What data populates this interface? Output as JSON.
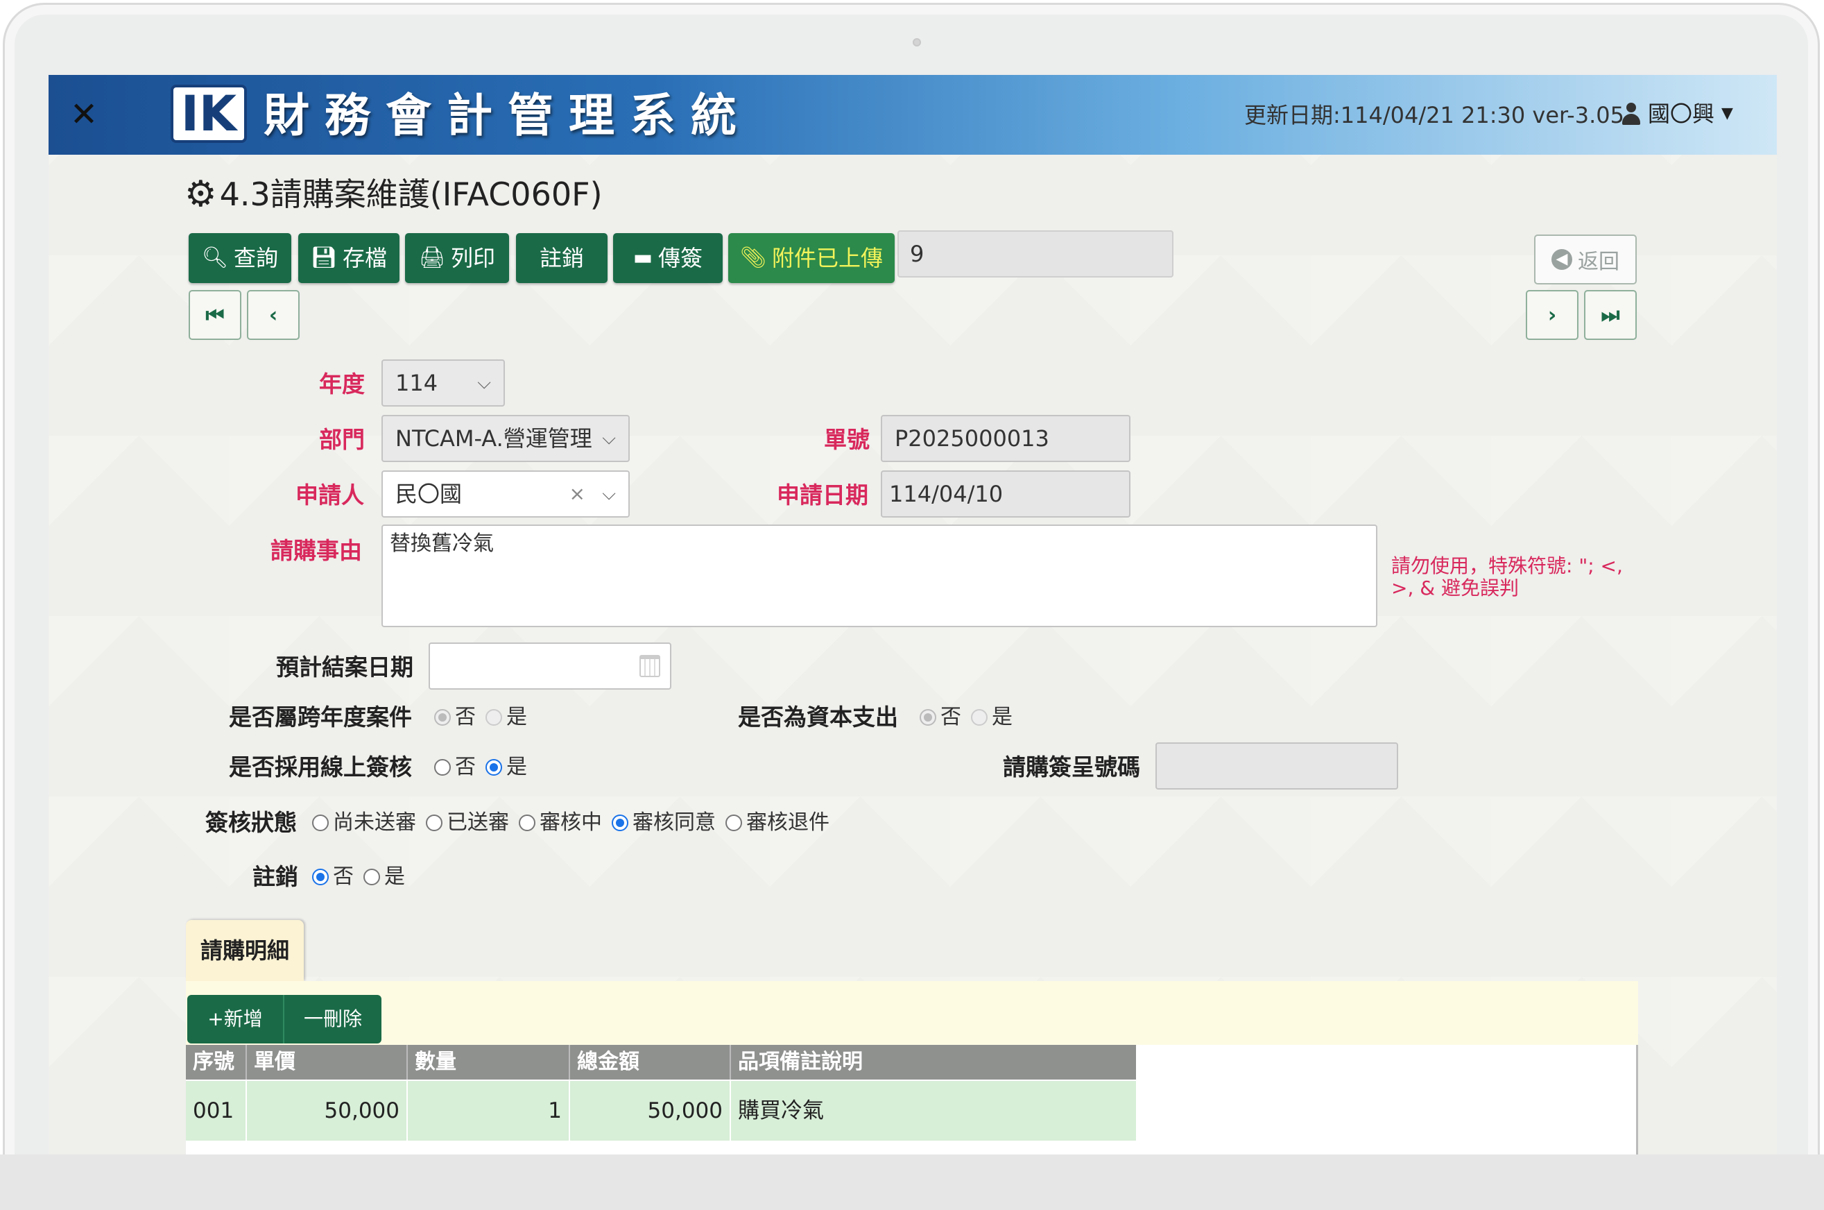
{
  "header": {
    "logo_text": "IK",
    "app_title": "財務會計管理系統",
    "update_info": "更新日期:114/04/21 21:30 ver-3.05",
    "user_name": "國〇興"
  },
  "page": {
    "title": "4.3請購案維護(IFAC060F)"
  },
  "toolbar": {
    "query_label": "查詢",
    "save_label": "存檔",
    "print_label": "列印",
    "cancel_label": "註銷",
    "sign_label": "傳簽",
    "attach_label": "附件已上傳",
    "attach_count": "9",
    "back_label": "返回"
  },
  "form": {
    "year_label": "年度",
    "year_value": "114",
    "dept_label": "部門",
    "dept_value": "NTCAM-A.營運管理",
    "doc_no_label": "單號",
    "doc_no_value": "P2025000013",
    "applicant_label": "申請人",
    "applicant_value": "民〇國",
    "apply_date_label": "申請日期",
    "apply_date_value": "114/04/10",
    "reason_label": "請購事由",
    "reason_value": "替換舊冷氣",
    "reason_warning": "請勿使用，特殊符號: \"; <, >, & 避免誤判",
    "close_date_label": "預計結案日期",
    "close_date_value": "",
    "cross_year_label": "是否屬跨年度案件",
    "capital_label": "是否為資本支出",
    "online_sign_label": "是否採用線上簽核",
    "sign_no_label": "請購簽呈號碼",
    "sign_no_value": "",
    "sign_status_label": "簽核狀態",
    "cancel_flag_label": "註銷",
    "opt_no": "否",
    "opt_yes": "是",
    "status_options": [
      "尚未送審",
      "已送審",
      "審核中",
      "審核同意",
      "審核退件"
    ],
    "status_selected": "審核同意"
  },
  "detail": {
    "tab_label": "請購明細",
    "add_label": "+新增",
    "delete_label": "一刪除",
    "columns": [
      "序號",
      "單價",
      "數量",
      "總金額",
      "品項備註說明"
    ],
    "rows": [
      [
        "001",
        "50,000",
        "1",
        "50,000",
        "購買冷氣"
      ]
    ]
  }
}
